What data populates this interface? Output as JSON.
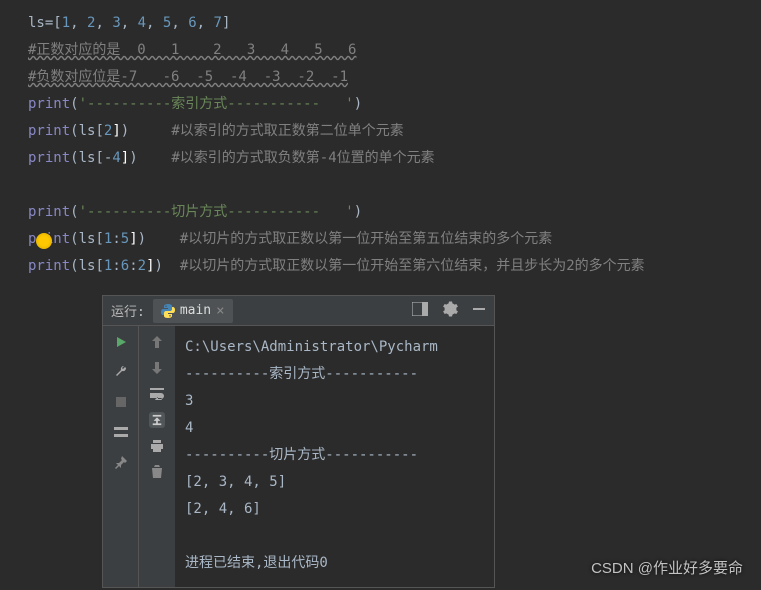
{
  "code": {
    "l1_pre": "ls=[",
    "l1_nums": [
      "1",
      "2",
      "3",
      "4",
      "5",
      "6",
      "7"
    ],
    "l1_sep": ", ",
    "l1_end": "]",
    "l2": "#正数对应的是  0   1    2   3   4   5   6",
    "l3": "#负数对应位是-7   -6  -5  -4  -3  -2  -1",
    "l4_print": "print",
    "l4_str": "'----------索引方式-----------   '",
    "l5_print": "print",
    "l5_arg": "ls[",
    "l5_num": "2",
    "l5_close": "]",
    "l5_comment": "#以索引的方式取正数第二位单个元素",
    "l6_print": "print",
    "l6_arg": "ls[-",
    "l6_num": "4",
    "l6_close": "]",
    "l6_comment": "#以索引的方式取负数第-4位置的单个元素",
    "l7_print": "print",
    "l7_str": "'----------切片方式-----------   '",
    "l8_print": "print",
    "l8_pre": "ls[",
    "l8_n1": "1",
    "l8_colon1": ":",
    "l8_n2": "5",
    "l8_close": "]",
    "l8_comment": "#以切片的方式取正数以第一位开始至第五位结束的多个元素",
    "l9_print": "print",
    "l9_pre": "ls[",
    "l9_n1": "1",
    "l9_c1": ":",
    "l9_n2": "6",
    "l9_c2": ":",
    "l9_n3": "2",
    "l9_close": "]",
    "l9_comment": "#以切片的方式取正数以第一位开始至第六位结束，并且步长为2的多个元素"
  },
  "run": {
    "label": "运行:",
    "tab_name": "main",
    "output": "C:\\Users\\Administrator\\Pycharm\n----------索引方式-----------   \n3\n4\n----------切片方式-----------   \n[2, 3, 4, 5]\n[2, 4, 6]\n\n进程已结束,退出代码0"
  },
  "watermark": "CSDN @作业好多要命"
}
